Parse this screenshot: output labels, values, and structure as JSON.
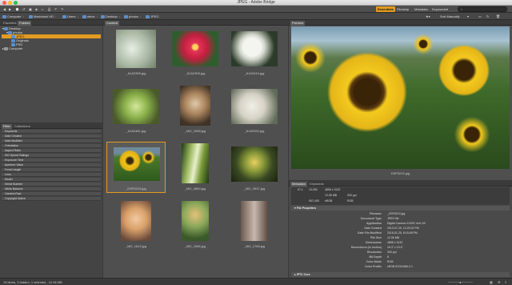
{
  "window": {
    "title": "JPEG - Adobe Bridge"
  },
  "workspaces": [
    "Essentials",
    "Filmstrip",
    "Metadata",
    "Keywords"
  ],
  "sort": {
    "label": "Sort Manually"
  },
  "search": {
    "placeholder": ""
  },
  "breadcrumb": [
    "Computer",
    "Macintosh HD",
    "Users",
    "steve",
    "Desktop",
    "photos",
    "JPEG"
  ],
  "favorites_panel": {
    "tabs": [
      "Favorites",
      "Folders"
    ],
    "items": [
      "Desktop",
      "photos",
      "JPEG",
      "Originals",
      "PSD",
      "Computer"
    ]
  },
  "filter_panel": {
    "tabs": [
      "Filter",
      "Collections"
    ],
    "items": [
      "Keywords",
      "Date Created",
      "Date Modified",
      "Orientation",
      "Aspect Ratio",
      "ISO Speed Ratings",
      "Exposure Time",
      "Aperture Value",
      "Focal Length",
      "Lens",
      "Model",
      "Serial Number",
      "White Balance",
      "Camera Raw",
      "Copyright Notice"
    ]
  },
  "content_panel": {
    "title": "Content",
    "thumbs": [
      {
        "name": "_61A2399.jpg"
      },
      {
        "name": "_61A2305.jpg"
      },
      {
        "name": "_61A2410.jpg"
      },
      {
        "name": "_61A2481.jpg"
      },
      {
        "name": "_MG_1558.jpg"
      },
      {
        "name": "_61A2532.jpg"
      },
      {
        "name": "_DSF5219.jpg"
      },
      {
        "name": "_MG_0850.jpg"
      },
      {
        "name": "_MG_0937.jpg"
      },
      {
        "name": "_MG_1613.jpg"
      },
      {
        "name": "_MG_1586.jpg"
      },
      {
        "name": "_MG_1766.jpg"
      }
    ],
    "selected_index": 6
  },
  "preview_panel": {
    "title": "Preview",
    "caption": "DSF5219.jpg"
  },
  "metadata_panel": {
    "tabs": [
      "Metadata",
      "Keywords"
    ],
    "summary": [
      "f/7.1",
      "1/1250",
      "4896 x 3132",
      "12.06 MB",
      "300 ppi",
      "ISO 400",
      "sRGB",
      "RGB"
    ],
    "section": "File Properties",
    "rows": [
      {
        "k": "Filename",
        "v": "_DSF5219.jpg"
      },
      {
        "k": "Document Type",
        "v": "JPEG file"
      },
      {
        "k": "Application",
        "v": "Digital Camera X100S Ver1.00"
      },
      {
        "k": "Date Created",
        "v": "2013-07-29, 12:20:02 PM"
      },
      {
        "k": "Date File Modified",
        "v": "2015-01-25, 8:15:48 PM"
      },
      {
        "k": "File Size",
        "v": "12.06 MB"
      },
      {
        "k": "Dimensions",
        "v": "4896 x 3132"
      },
      {
        "k": "Dimensions (in inches)",
        "v": "16.3\" x 10.4\""
      },
      {
        "k": "Resolution",
        "v": "300 ppi"
      },
      {
        "k": "Bit Depth",
        "v": "8"
      },
      {
        "k": "Color Mode",
        "v": "RGB"
      },
      {
        "k": "Color Profile",
        "v": "sRGB IEC61966-2.1"
      }
    ],
    "footer": "IPTC Core"
  },
  "status": {
    "text": "15 items, 3 hidden, 1 selected - 12.06 MB"
  }
}
